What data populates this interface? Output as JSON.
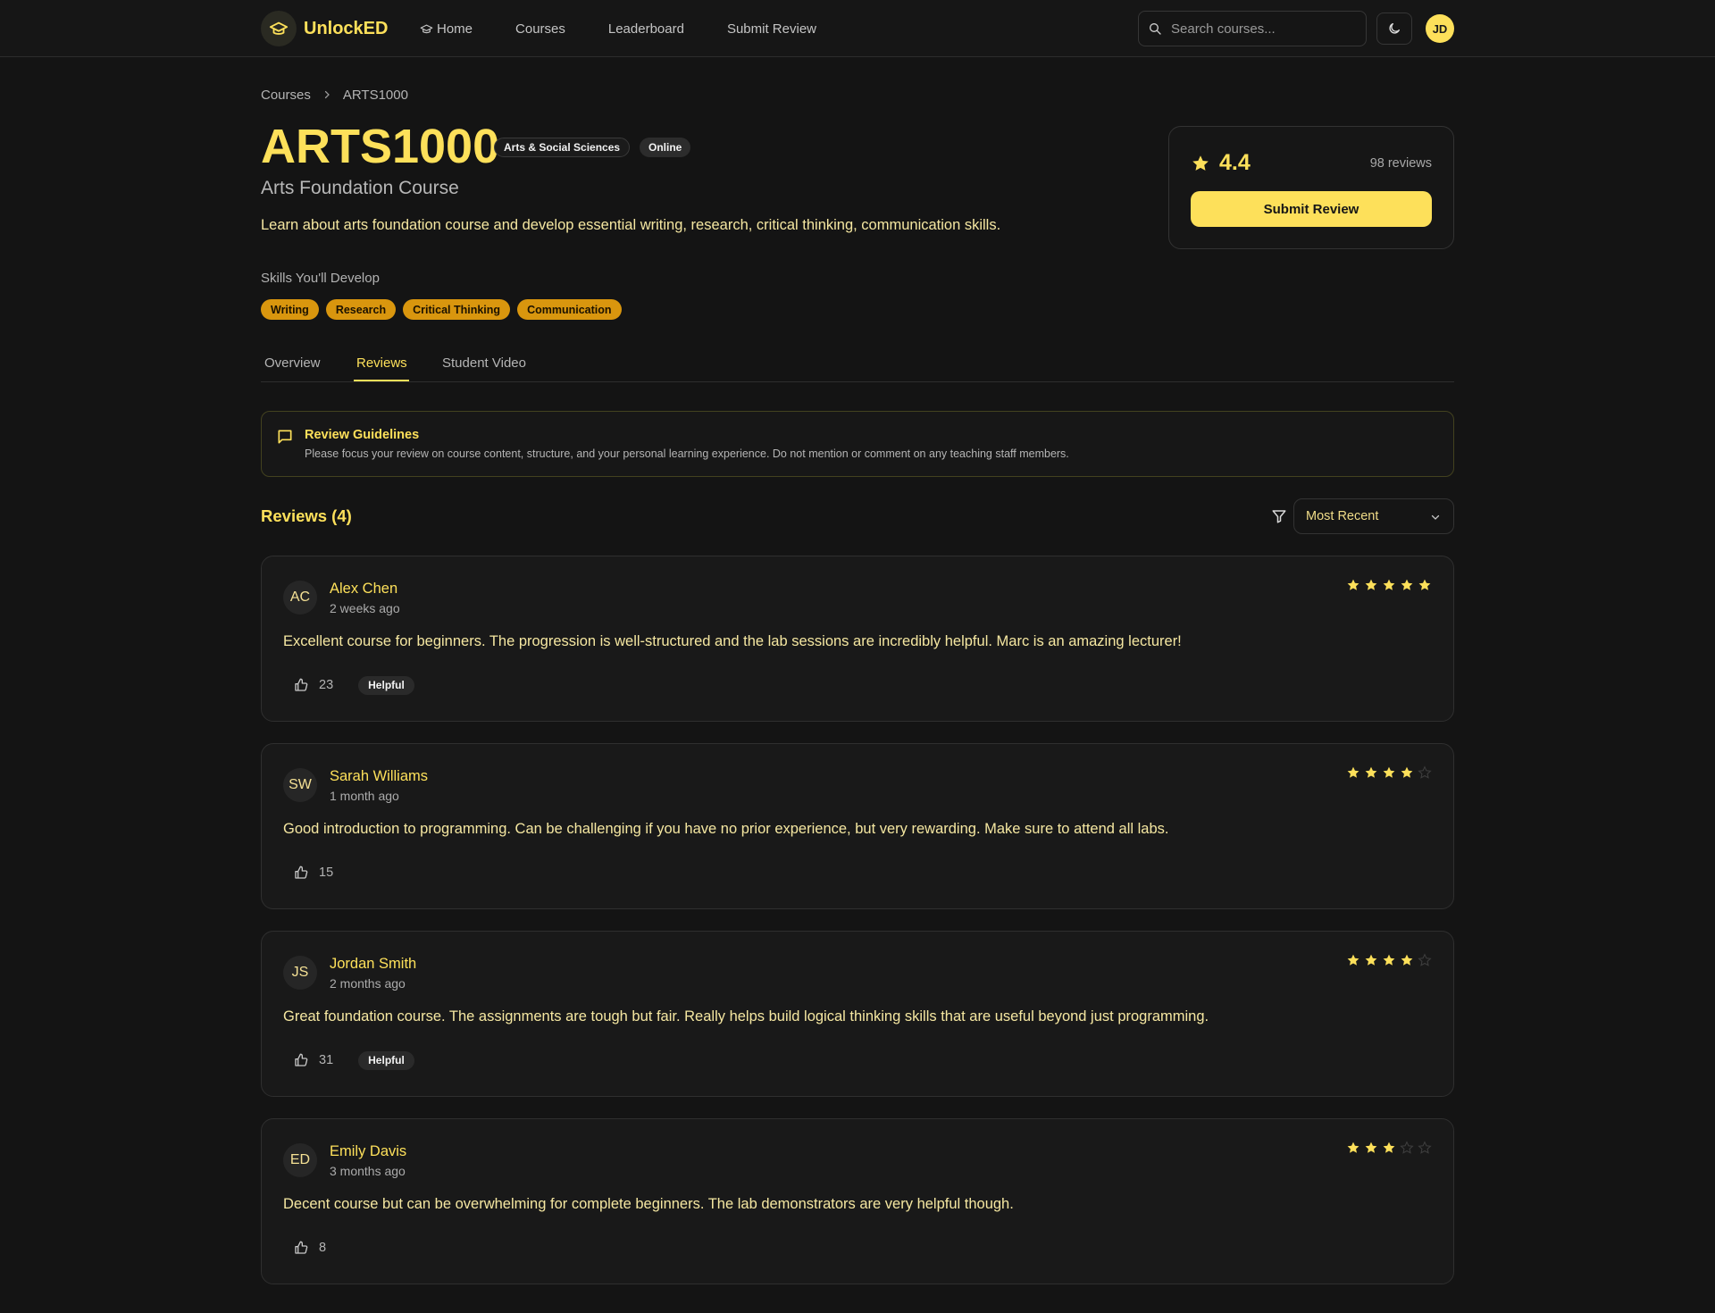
{
  "colors": {
    "accent": "#fde05a",
    "skill_bg": "#d9960e",
    "background": "#141414"
  },
  "nav": {
    "brand": "UnlockED",
    "links": [
      "Home",
      "Courses",
      "Leaderboard",
      "Submit Review"
    ],
    "search_placeholder": "Search courses...",
    "user_initials": "JD"
  },
  "breadcrumb": [
    "Courses",
    "ARTS1000"
  ],
  "course": {
    "code": "ARTS1000",
    "faculty": "Arts & Social Sciences",
    "mode": "Online",
    "name": "Arts Foundation Course",
    "description": "Learn about arts foundation course and develop essential writing, research, critical thinking, communication skills.",
    "skills_label": "Skills You'll Develop",
    "skills": [
      "Writing",
      "Research",
      "Critical Thinking",
      "Communication"
    ]
  },
  "rating": {
    "value": "4.4",
    "count": "98 reviews",
    "submit_label": "Submit Review"
  },
  "tabs": {
    "items": [
      "Overview",
      "Reviews",
      "Student Video"
    ],
    "active": "Reviews"
  },
  "guidelines": {
    "title": "Review Guidelines",
    "text": "Please focus your review on course content, structure, and your personal learning experience. Do not mention or comment on any teaching staff members."
  },
  "reviews_section": {
    "title": "Reviews (4)",
    "sort": "Most Recent"
  },
  "reviews": [
    {
      "initials": "AC",
      "name": "Alex Chen",
      "time": "2 weeks ago",
      "stars": 5,
      "text": "Excellent course for beginners. The progression is well-structured and the lab sessions are incredibly helpful. Marc is an amazing lecturer!",
      "likes": "23",
      "badge": "Helpful"
    },
    {
      "initials": "SW",
      "name": "Sarah Williams",
      "time": "1 month ago",
      "stars": 4,
      "text": "Good introduction to programming. Can be challenging if you have no prior experience, but very rewarding. Make sure to attend all labs.",
      "likes": "15",
      "badge": ""
    },
    {
      "initials": "JS",
      "name": "Jordan Smith",
      "time": "2 months ago",
      "stars": 4,
      "text": "Great foundation course. The assignments are tough but fair. Really helps build logical thinking skills that are useful beyond just programming.",
      "likes": "31",
      "badge": "Helpful"
    },
    {
      "initials": "ED",
      "name": "Emily Davis",
      "time": "3 months ago",
      "stars": 3,
      "text": "Decent course but can be overwhelming for complete beginners. The lab demonstrators are very helpful though.",
      "likes": "8",
      "badge": ""
    }
  ]
}
